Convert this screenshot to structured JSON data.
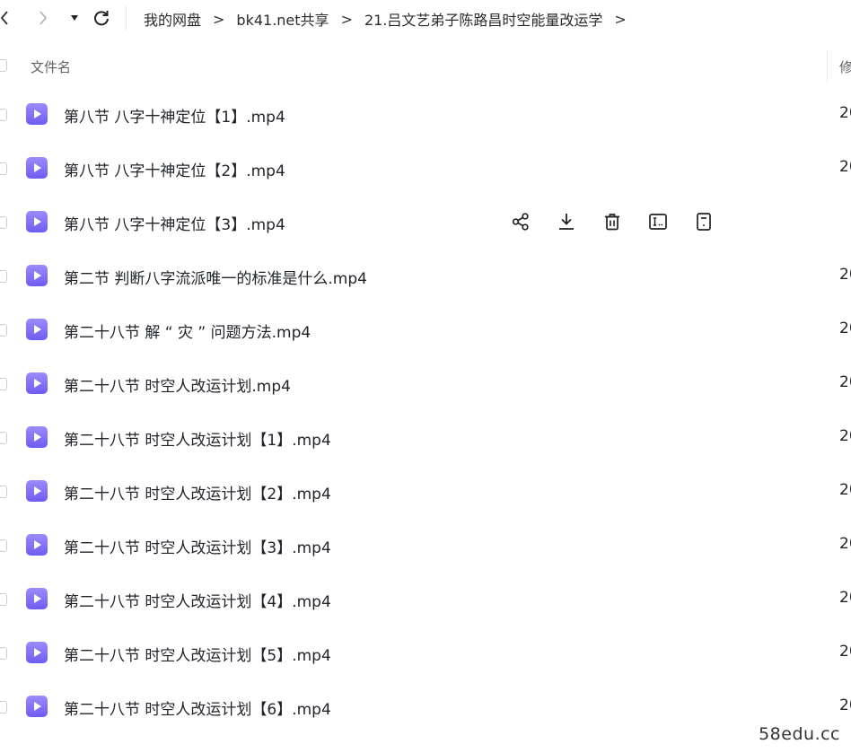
{
  "nav": {
    "back_icon": "chevron-left-icon",
    "forward_icon": "chevron-right-icon",
    "dropdown_icon": "caret-down-icon",
    "refresh_icon": "refresh-icon",
    "breadcrumb": [
      "我的网盘",
      "bk41.net共享",
      "21.吕文艺弟子陈路昌时空能量改运学"
    ],
    "separator": ">"
  },
  "header": {
    "name_label": "文件名",
    "modified_label": "修"
  },
  "files": [
    {
      "name": "第八节 八字十神定位【1】.mp4",
      "modified": "20"
    },
    {
      "name": "第八节 八字十神定位【2】.mp4",
      "modified": "20"
    },
    {
      "name": "第八节 八字十神定位【3】.mp4",
      "modified": ""
    },
    {
      "name": "第二节 判断八字流派唯一的标准是什么.mp4",
      "modified": "20"
    },
    {
      "name": "第二十八节 解 “ 灾 ” 问题方法.mp4",
      "modified": "20"
    },
    {
      "name": "第二十八节 时空人改运计划.mp4",
      "modified": "20"
    },
    {
      "name": "第二十八节 时空人改运计划【1】.mp4",
      "modified": "20"
    },
    {
      "name": "第二十八节 时空人改运计划【2】.mp4",
      "modified": "20"
    },
    {
      "name": "第二十八节 时空人改运计划【3】.mp4",
      "modified": "20"
    },
    {
      "name": "第二十八节 时空人改运计划【4】.mp4",
      "modified": "20"
    },
    {
      "name": "第二十八节 时空人改运计划【5】.mp4",
      "modified": "20"
    },
    {
      "name": "第二十八节 时空人改运计划【6】.mp4",
      "modified": "20"
    }
  ],
  "hover_row_index": 2,
  "hover_actions": [
    "share-icon",
    "download-icon",
    "delete-icon",
    "rename-icon",
    "details-icon"
  ],
  "file_icon": "video-file-icon",
  "accent_color": "#7b6cf6",
  "watermark": "58edu.cc"
}
